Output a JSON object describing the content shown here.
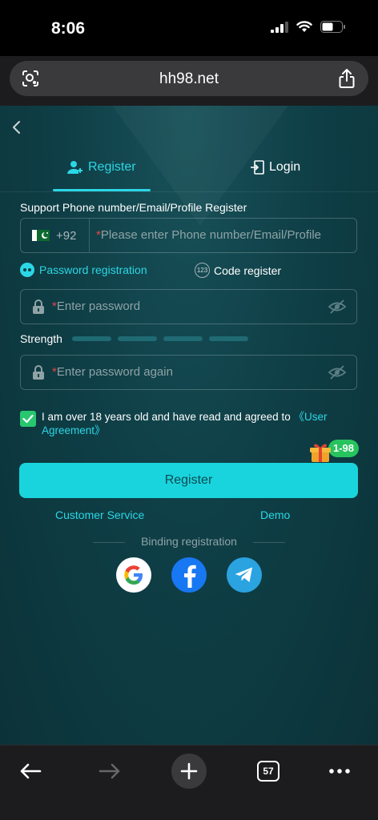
{
  "status": {
    "time": "8:06"
  },
  "browser": {
    "url": "hh98.net",
    "tab_count": "57"
  },
  "tabs": {
    "register": "Register",
    "login": "Login"
  },
  "form": {
    "support_text": "Support Phone number/Email/Profile Register",
    "country_code": "+92",
    "phone_placeholder_required": "*",
    "phone_placeholder": "Please enter Phone number/Email/Profile",
    "password_registration": "Password registration",
    "code_register": "Code register",
    "code_icon_text": "123",
    "password_required": "*",
    "password_placeholder": "Enter password",
    "strength_label": "Strength",
    "strength_level": 0,
    "password_again_required": "*",
    "password_again_placeholder": "Enter password again",
    "agree_checked": true,
    "agree_text": "I am over 18 years old and have read and agreed to ",
    "agree_link": "《User Agreement》",
    "gift_badge": "1-98",
    "register_button": "Register"
  },
  "links": {
    "customer_service": "Customer Service",
    "demo": "Demo"
  },
  "binding": {
    "label": "Binding registration"
  },
  "colors": {
    "accent": "#2bd7e5",
    "button": "#19d4dc",
    "check": "#28c76f",
    "background": "#0f3f47"
  }
}
